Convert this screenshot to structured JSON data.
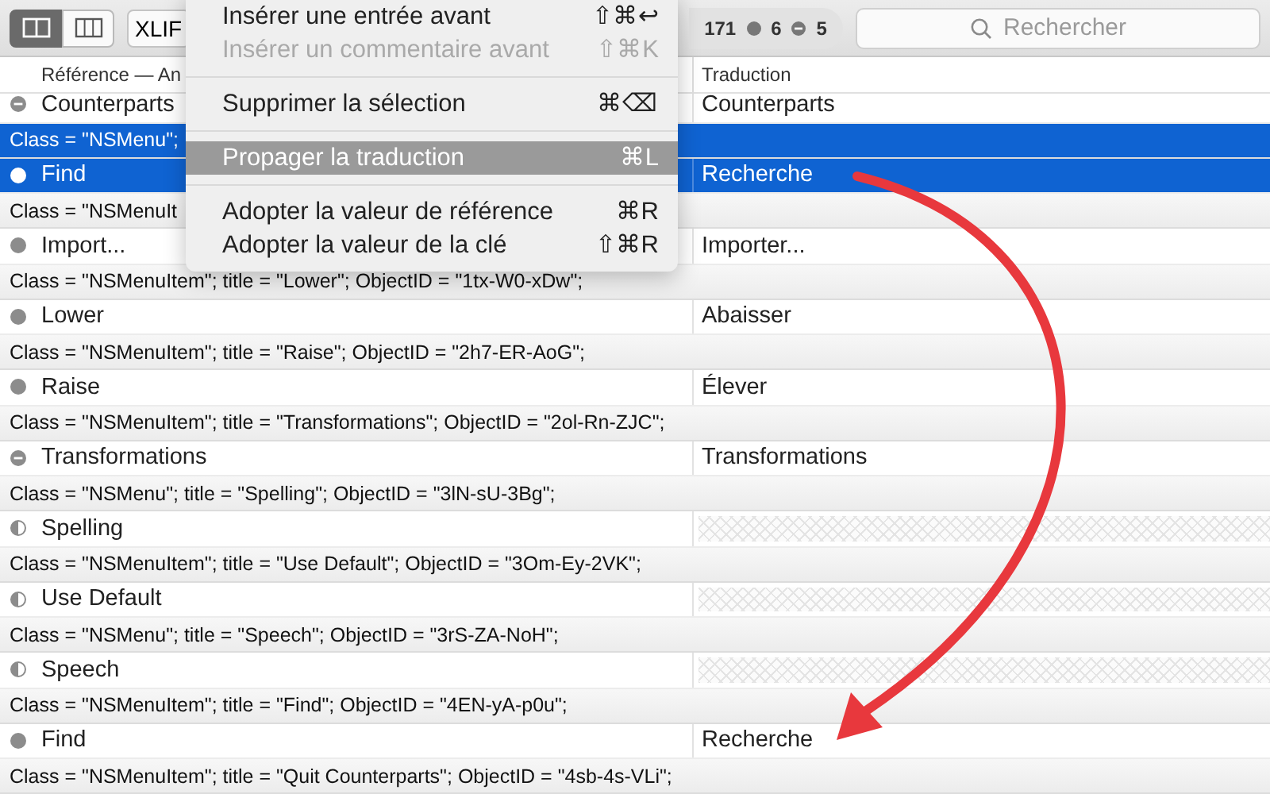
{
  "toolbar": {
    "view_modes": [
      {
        "kind": "two-columns",
        "selected": true
      },
      {
        "kind": "three-columns",
        "selected": false
      }
    ],
    "format_button": "XLIF",
    "counts": [
      {
        "kind": "total",
        "text": "171"
      },
      {
        "kind": "dot",
        "text": "6"
      },
      {
        "kind": "minus",
        "text": "5"
      }
    ],
    "search": {
      "placeholder": "Rechercher"
    }
  },
  "table": {
    "columns": [
      "Référence — An",
      "Traduction"
    ],
    "rows": [
      {
        "kind": "entry",
        "status": {
          "kind": "minus"
        },
        "reference": "Counterparts",
        "translation": "Counterparts",
        "selected": false
      },
      {
        "kind": "comment",
        "text": "Class = \"NSMenu\";",
        "selected": true
      },
      {
        "kind": "entry",
        "status": {
          "kind": "dot"
        },
        "reference": "Find",
        "translation": "Recherche",
        "selected": true
      },
      {
        "kind": "comment",
        "text": "Class = \"NSMenuIt",
        "selected": false
      },
      {
        "kind": "entry",
        "status": {
          "kind": "dot"
        },
        "reference": "Import...",
        "translation": "Importer...",
        "selected": false
      },
      {
        "kind": "comment",
        "text": "Class = \"NSMenuItem\"; title = \"Lower\"; ObjectID = \"1tx-W0-xDw\";",
        "selected": false
      },
      {
        "kind": "entry",
        "status": {
          "kind": "dot"
        },
        "reference": "Lower",
        "translation": "Abaisser",
        "selected": false
      },
      {
        "kind": "comment",
        "text": "Class = \"NSMenuItem\"; title = \"Raise\"; ObjectID = \"2h7-ER-AoG\";",
        "selected": false
      },
      {
        "kind": "entry",
        "status": {
          "kind": "dot"
        },
        "reference": "Raise",
        "translation": "Élever",
        "selected": false
      },
      {
        "kind": "comment",
        "text": "Class = \"NSMenuItem\"; title = \"Transformations\"; ObjectID = \"2ol-Rn-ZJC\";",
        "selected": false
      },
      {
        "kind": "entry",
        "status": {
          "kind": "minus"
        },
        "reference": "Transformations",
        "translation": "Transformations",
        "selected": false
      },
      {
        "kind": "comment",
        "text": "Class = \"NSMenu\"; title = \"Spelling\"; ObjectID = \"3lN-sU-3Bg\";",
        "selected": false
      },
      {
        "kind": "entry",
        "status": {
          "kind": "half"
        },
        "reference": "Spelling",
        "selected": false
      },
      {
        "kind": "comment",
        "text": "Class = \"NSMenuItem\"; title = \"Use Default\"; ObjectID = \"3Om-Ey-2VK\";",
        "selected": false
      },
      {
        "kind": "entry",
        "status": {
          "kind": "half"
        },
        "reference": "Use Default",
        "selected": false
      },
      {
        "kind": "comment",
        "text": "Class = \"NSMenu\"; title = \"Speech\"; ObjectID = \"3rS-ZA-NoH\";",
        "selected": false
      },
      {
        "kind": "entry",
        "status": {
          "kind": "half"
        },
        "reference": "Speech",
        "selected": false
      },
      {
        "kind": "comment",
        "text": "Class = \"NSMenuItem\"; title = \"Find\"; ObjectID = \"4EN-yA-p0u\";",
        "selected": false
      },
      {
        "kind": "entry",
        "status": {
          "kind": "dot"
        },
        "reference": "Find",
        "translation": "Recherche",
        "selected": false
      },
      {
        "kind": "comment",
        "text": "Class = \"NSMenuItem\"; title = \"Quit Counterparts\"; ObjectID = \"4sb-4s-VLi\";",
        "selected": false
      }
    ]
  },
  "context_menu": {
    "items": [
      {
        "kind": "item",
        "label": "Insérer une entrée avant",
        "shortcut": "⇧⌘↩",
        "disabled": false,
        "selected": false
      },
      {
        "kind": "item",
        "label": "Insérer un commentaire avant",
        "shortcut": "⇧⌘K",
        "disabled": true,
        "selected": false
      },
      {
        "kind": "separator"
      },
      {
        "kind": "item",
        "label": "Supprimer la sélection",
        "shortcut": "⌘⌫",
        "disabled": false,
        "selected": false
      },
      {
        "kind": "separator"
      },
      {
        "kind": "item",
        "label": "Propager la traduction",
        "shortcut": "⌘L",
        "disabled": true,
        "selected": true
      },
      {
        "kind": "separator"
      },
      {
        "kind": "item",
        "label": "Adopter la valeur de référence",
        "shortcut": "⌘R",
        "disabled": false,
        "selected": false
      },
      {
        "kind": "item",
        "label": "Adopter la valeur de la clé",
        "shortcut": "⇧⌘R",
        "disabled": false,
        "selected": false
      }
    ]
  },
  "annotation": {
    "kind": "curved-arrow"
  }
}
